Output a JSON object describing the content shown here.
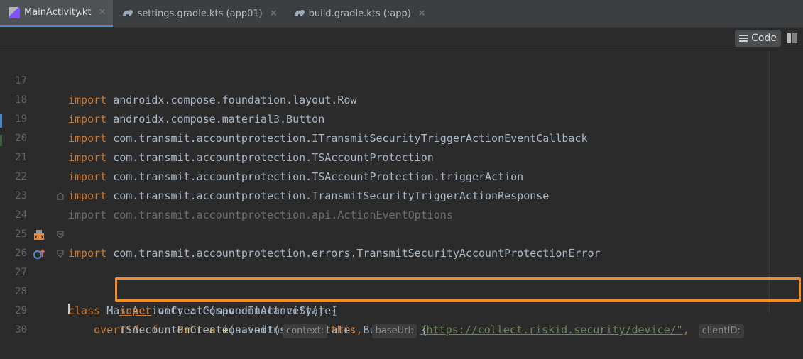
{
  "tabs": [
    {
      "label": "MainActivity.kt",
      "icon": "kotlin-file-icon",
      "active": true
    },
    {
      "label": "settings.gradle.kts (app01)",
      "icon": "gradle-icon",
      "active": false
    },
    {
      "label": "build.gradle.kts (:app)",
      "icon": "gradle-icon",
      "active": false
    }
  ],
  "toolbar": {
    "code_label": "Code"
  },
  "code": {
    "lines": [
      {
        "num": "17",
        "text": "androidx.compose.foundation.layout.Row"
      },
      {
        "num": "18",
        "text": "androidx.compose.material3.Button"
      },
      {
        "num": "19",
        "text": "com.transmit.accountprotection.ITransmitSecurityTriggerActionEventCallback"
      },
      {
        "num": "20",
        "text": "com.transmit.accountprotection.TSAccountProtection"
      },
      {
        "num": "21",
        "text": "com.transmit.accountprotection.TSAccountProtection.triggerAction"
      },
      {
        "num": "22",
        "text": "com.transmit.accountprotection.TransmitSecurityTriggerActionResponse"
      },
      {
        "num": "23",
        "text": "com.transmit.accountprotection.api.ActionEventOptions"
      },
      {
        "num": "24",
        "text": "com.transmit.accountprotection.errors.TransmitSecurityAccountProtectionError"
      },
      {
        "num": "25",
        "text": ""
      },
      {
        "num": "26",
        "kw": "class",
        "name": "MainActivity",
        "rest": " : ComponentActivity() {"
      },
      {
        "num": "27",
        "kw1": "override",
        "kw2": "fun",
        "fn": "onCreate",
        "rest": "(savedInstanceState: Bundle?) {"
      },
      {
        "num": "28",
        "kw": "super",
        "rest": ".onCreate(savedInstanceState)"
      },
      {
        "num": "29",
        "obj": "TSAccountProtection.init(",
        "hint1": "context:",
        "this": "this,",
        "hint2": "baseUrl:",
        "url": "\"https://collect.riskid.security/device/\"",
        "comma": ",",
        "hint3": "clientID:"
      },
      {
        "num": "30",
        "text": ""
      }
    ],
    "import_kw": "import"
  },
  "colors": {
    "highlight": "#F28C28",
    "keyword": "#CC7832",
    "string": "#6A8759",
    "function": "#FFC66D"
  }
}
